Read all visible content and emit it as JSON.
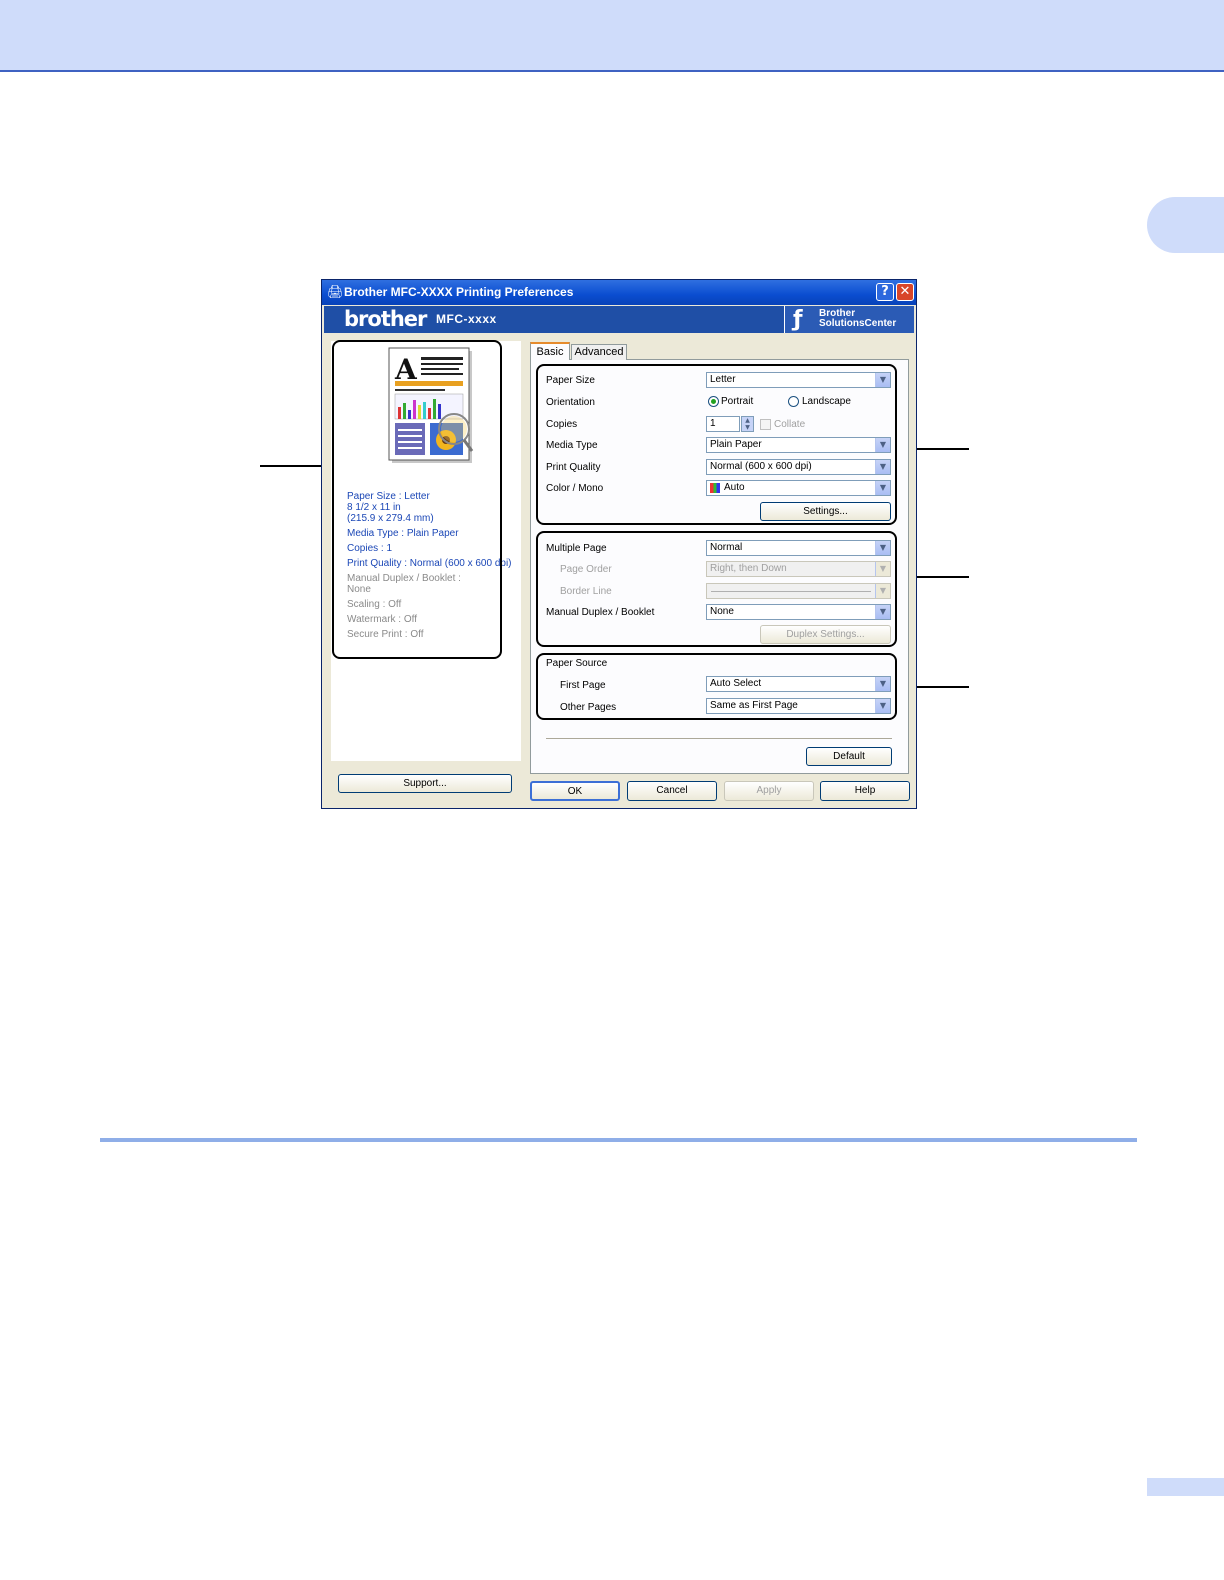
{
  "window": {
    "title": "Brother MFC-XXXX Printing Preferences",
    "brand": "brother",
    "model": "MFC-xxxx",
    "solutions_center": "Brother\nSolutionsCenter",
    "help_glyph": "?",
    "close_glyph": "✕"
  },
  "summary": {
    "paper_size": "Paper Size : Letter\n8 1/2 x 11 in\n(215.9 x 279.4 mm)",
    "media_type": "Media Type : Plain Paper",
    "copies": "Copies : 1",
    "print_quality": "Print Quality : Normal (600 x 600 dpi)",
    "manual_duplex": "Manual Duplex / Booklet :\nNone",
    "scaling": "Scaling : Off",
    "watermark": "Watermark : Off",
    "secure_print": "Secure Print : Off"
  },
  "tabs": {
    "basic": "Basic",
    "advanced": "Advanced"
  },
  "basic": {
    "paper_size_label": "Paper Size",
    "paper_size_value": "Letter",
    "orientation_label": "Orientation",
    "portrait": "Portrait",
    "landscape": "Landscape",
    "orientation_selected": "Portrait",
    "copies_label": "Copies",
    "copies_value": "1",
    "collate": "Collate",
    "media_type_label": "Media Type",
    "media_type_value": "Plain Paper",
    "print_quality_label": "Print Quality",
    "print_quality_value": "Normal (600 x 600 dpi)",
    "color_mono_label": "Color / Mono",
    "color_mono_value": "Auto",
    "settings_button": "Settings...",
    "multiple_page_label": "Multiple Page",
    "multiple_page_value": "Normal",
    "page_order_label": "Page Order",
    "page_order_value": "Right, then Down",
    "border_line_label": "Border Line",
    "border_line_value": "",
    "manual_duplex_label": "Manual Duplex / Booklet",
    "manual_duplex_value": "None",
    "duplex_settings_button": "Duplex Settings...",
    "paper_source_label": "Paper Source",
    "first_page_label": "First Page",
    "first_page_value": "Auto Select",
    "other_pages_label": "Other Pages",
    "other_pages_value": "Same as First Page",
    "default_button": "Default"
  },
  "buttons": {
    "support": "Support...",
    "ok": "OK",
    "cancel": "Cancel",
    "apply": "Apply",
    "help": "Help"
  },
  "colors": {
    "page_accent": "#cfdcfa",
    "title_bar": "#0a4dd0",
    "banner": "#1f4fa6",
    "summary_text": "#1b47b6"
  },
  "icons": {
    "title": "printer-icon",
    "color_mono": "color-palette-icon",
    "dropdown": "chevron-down-icon"
  }
}
